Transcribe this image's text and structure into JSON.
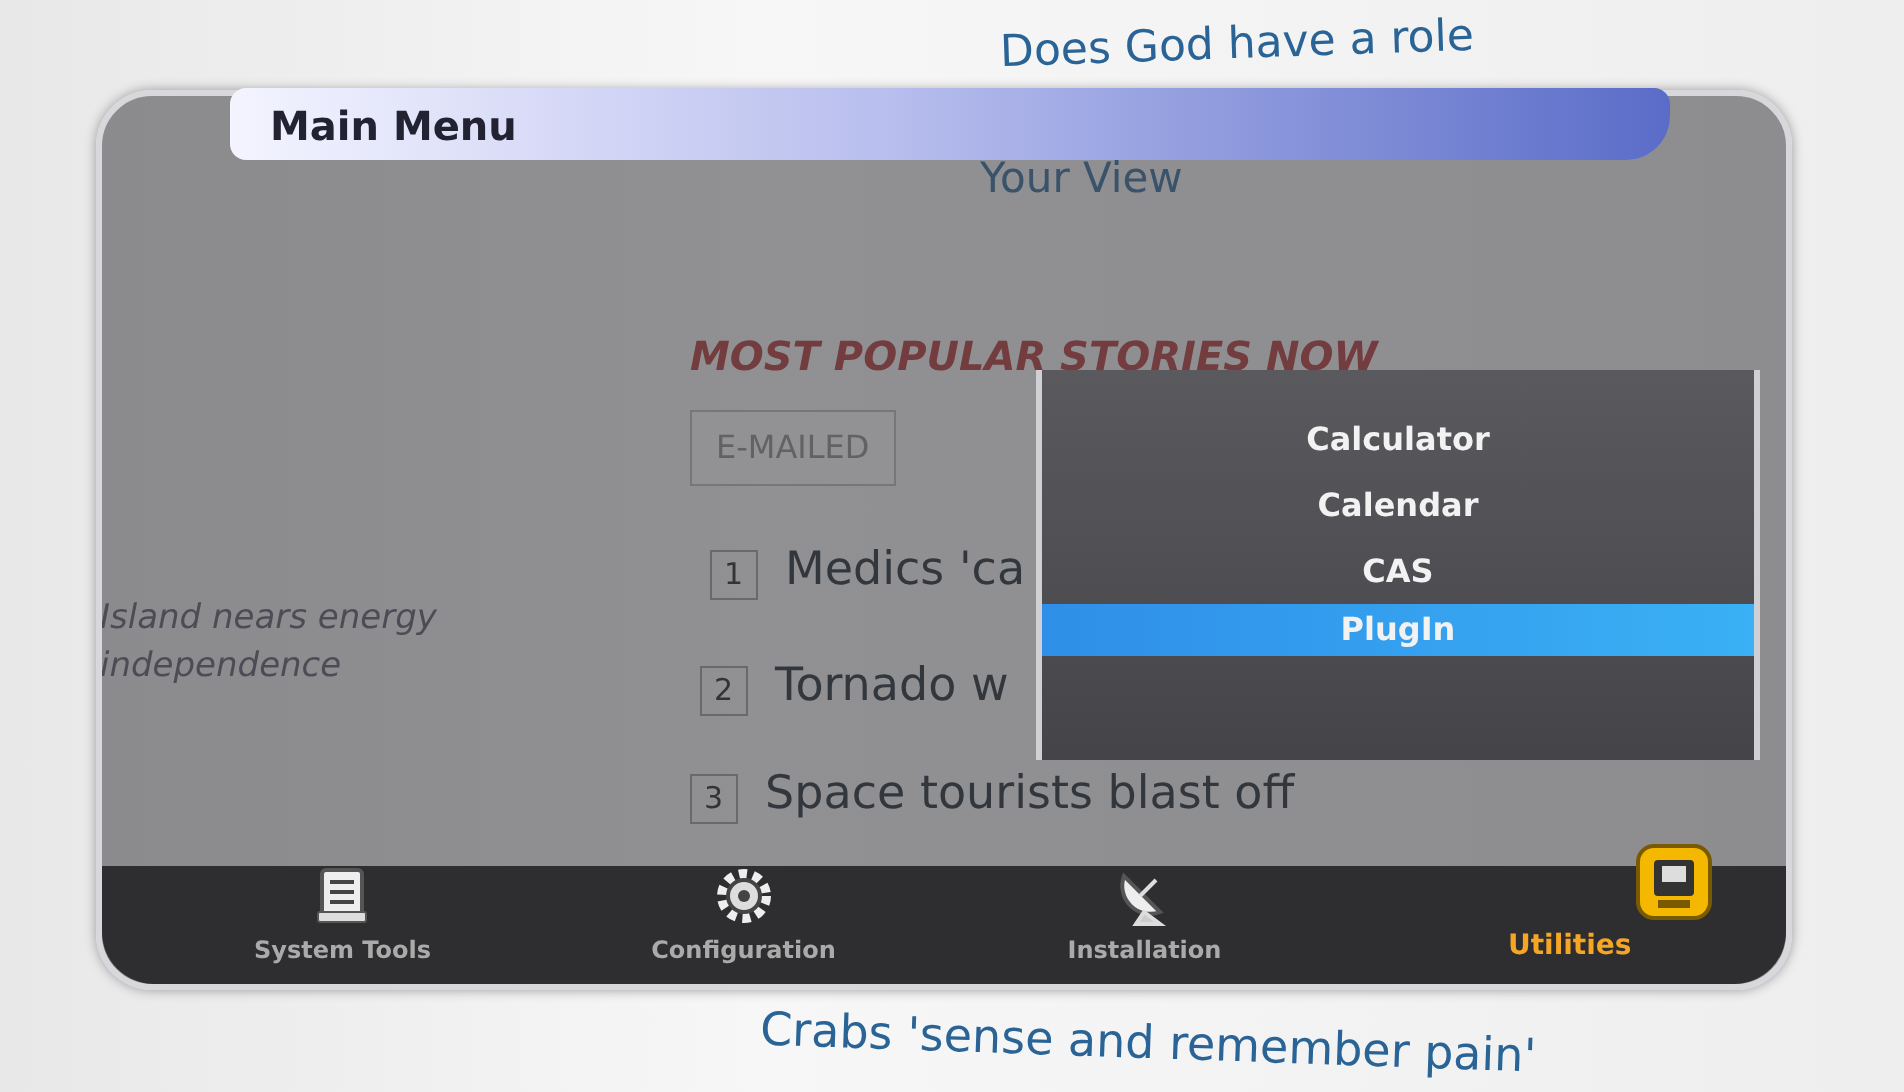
{
  "background_page": {
    "headline": "Does God have a role",
    "your_view": "Your View",
    "side_story": "Island nears energy independence",
    "section_title": "MOST POPULAR STORIES NOW",
    "tabs": [
      {
        "label": "E-MAILED",
        "selected": true
      }
    ],
    "stories": [
      {
        "number": "1",
        "title": "Medics 'ca"
      },
      {
        "number": "2",
        "title": "Tornado w"
      },
      {
        "number": "3",
        "title": "Space tourists blast off"
      }
    ],
    "last_story": "Crabs 'sense and remember pain'"
  },
  "menu": {
    "title": "Main Menu",
    "submenu": [
      {
        "label": "Calculator",
        "selected": false
      },
      {
        "label": "Calendar",
        "selected": false
      },
      {
        "label": "CAS",
        "selected": false
      },
      {
        "label": "PlugIn",
        "selected": true
      }
    ],
    "categories": [
      {
        "label": "System Tools",
        "kind": "tools",
        "selected": false
      },
      {
        "label": "Configuration",
        "kind": "gear",
        "selected": false
      },
      {
        "label": "Installation",
        "kind": "dish",
        "selected": false
      },
      {
        "label": "Utilities",
        "kind": "utilities",
        "selected": true
      }
    ]
  }
}
